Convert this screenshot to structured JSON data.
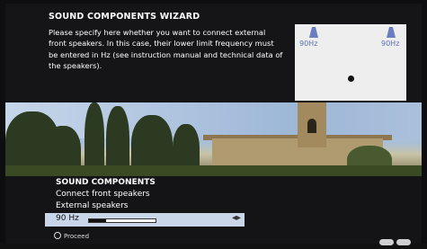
{
  "wizard": {
    "title": "SOUND COMPONENTS WIZARD",
    "text": "Please specify here whether you want to connect external front speakers. In this case, their lower limit frequency must be entered in Hz (see instruction manual and technical data of the speakers).",
    "diagram": {
      "left_label": "90Hz",
      "right_label": "90Hz"
    }
  },
  "menu": {
    "title": "SOUND COMPONENTS",
    "items": [
      "Connect front speakers",
      "External speakers"
    ],
    "slider": {
      "value_label": "90 Hz",
      "level": 0.25
    },
    "proceed_label": "Proceed"
  },
  "icons": [
    "speaker-icon",
    "listener-dot-icon",
    "arrows-icon",
    "radio-dot-icon",
    "nav-pill-icon"
  ]
}
